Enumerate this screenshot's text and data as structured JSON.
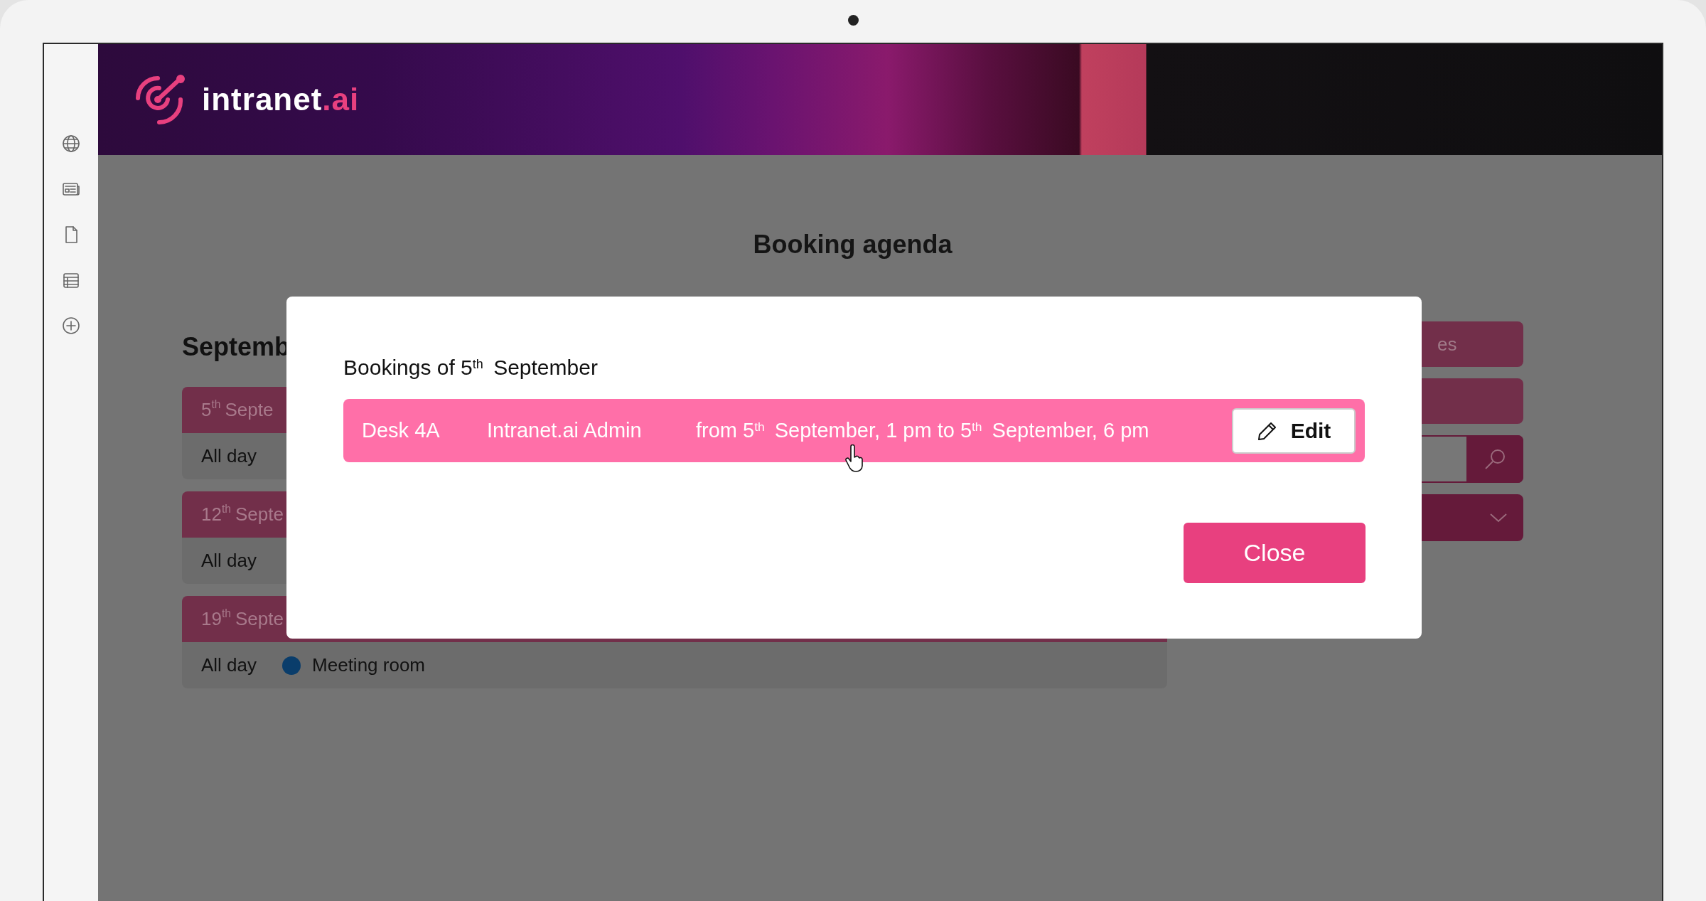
{
  "logo": {
    "text": "intranet",
    "accent": ".ai"
  },
  "page_title": "Booking agenda",
  "agenda": {
    "heading": "Septemb",
    "days": [
      {
        "date": "5$^{th}$ Septe",
        "entries": [
          {
            "time": "All day"
          }
        ]
      },
      {
        "date": "12$^{th}$ Septe",
        "entries": [
          {
            "time": "All day"
          }
        ]
      },
      {
        "date": "19$^{th}$ Septe",
        "entries": [
          {
            "time": "All day",
            "resource": "Meeting room",
            "color": "#0a3d6b"
          }
        ]
      }
    ]
  },
  "side_panel": [
    {
      "kind": "button",
      "label": "es"
    },
    {
      "kind": "button"
    },
    {
      "kind": "search"
    },
    {
      "kind": "dropdown"
    }
  ],
  "modal": {
    "title": "Bookings of 5$^{th}$ September",
    "bookings": [
      {
        "resource": "Desk 4A",
        "user": "Intranet.ai Admin",
        "period": "from 5$^{th}$ September, 1 pm to 5$^{th}$ September, 6 pm",
        "action": "Edit"
      }
    ],
    "close": "Close"
  }
}
